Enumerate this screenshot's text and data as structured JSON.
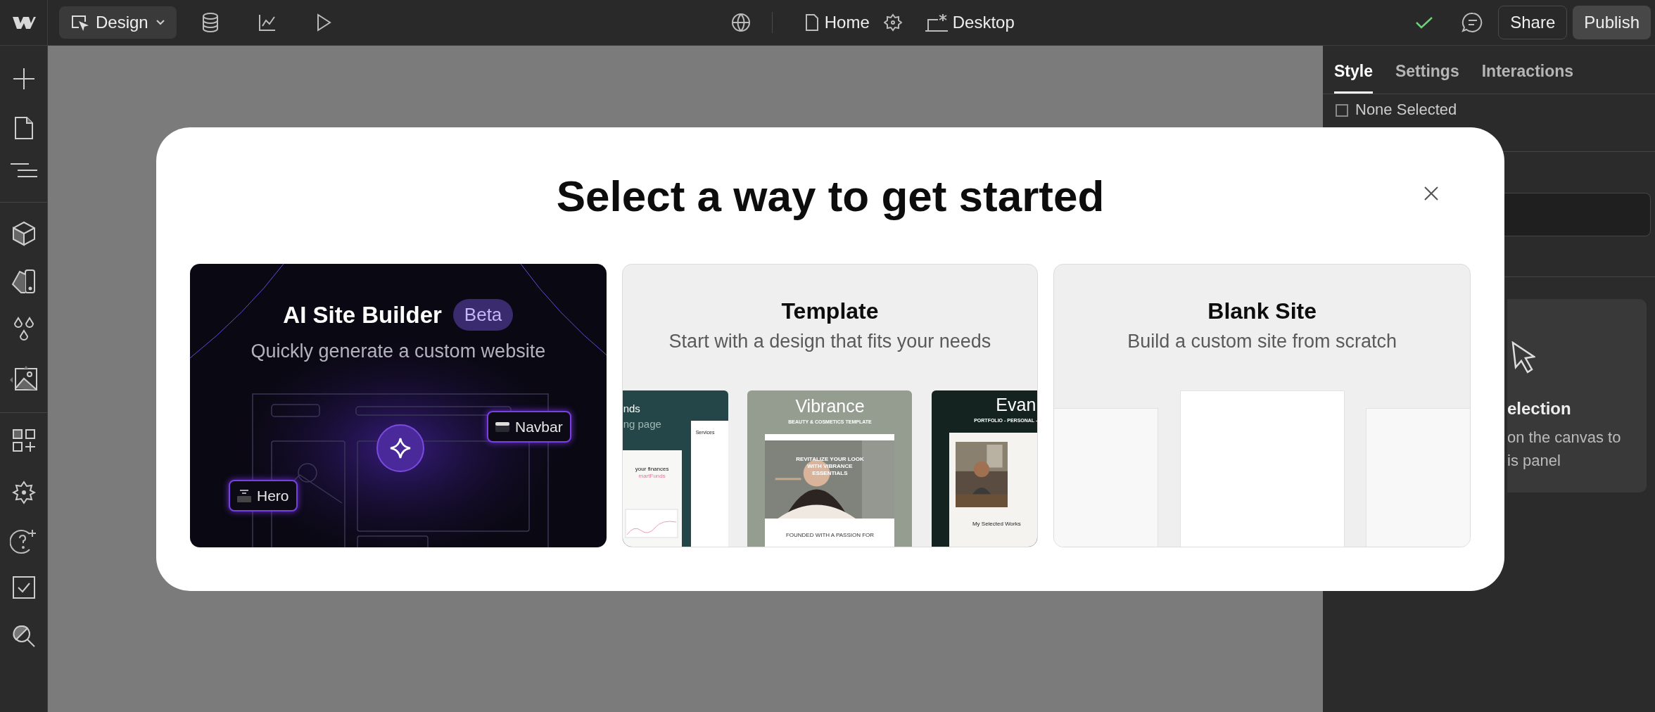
{
  "topbar": {
    "mode_button": "Design",
    "page": "Home",
    "breakpoint": "Desktop",
    "saved": true,
    "buttons": [
      "Share",
      "Publish"
    ]
  },
  "right_panel": {
    "tabs": [
      {
        "label": "Style",
        "selected": true
      },
      {
        "label": "Settings",
        "selected": false
      },
      {
        "label": "Interactions",
        "selected": false
      }
    ],
    "selector": {
      "label": "None Selected",
      "checked": false
    },
    "empty_state": {
      "title": "election",
      "lines": [
        "on the canvas to",
        "is panel"
      ]
    }
  },
  "modal": {
    "title": "Select a way to get started",
    "options": [
      {
        "kind": "ai",
        "title": "AI Site Builder",
        "badge": "Beta",
        "subtitle": "Quickly generate a custom website",
        "chips": [
          "Navbar",
          "Hero"
        ]
      },
      {
        "kind": "template",
        "title": "Template",
        "subtitle": "Start with a design that fits your needs",
        "thumbnails": [
          {
            "kind": "finance",
            "heading": "nds",
            "subheading": "ng page",
            "side_title": "Services",
            "card_title": "your finances",
            "card_brand": "martFunds"
          },
          {
            "kind": "beauty",
            "heading": "Vibrance",
            "subheading": "BEAUTY & COSMETICS TEMPLATE",
            "hero_text": "REVITALIZE YOUR LOOK WITH VIBRANCE ESSENTIALS",
            "footer_text": "FOUNDED WITH A PASSION FOR"
          },
          {
            "kind": "portfolio",
            "heading": "Evan",
            "subheading": "PORTFOLIO - PERSONAL -",
            "section_title": "My Selected Works"
          }
        ]
      },
      {
        "kind": "blank",
        "title": "Blank Site",
        "subtitle": "Build a custom site from scratch"
      }
    ]
  }
}
